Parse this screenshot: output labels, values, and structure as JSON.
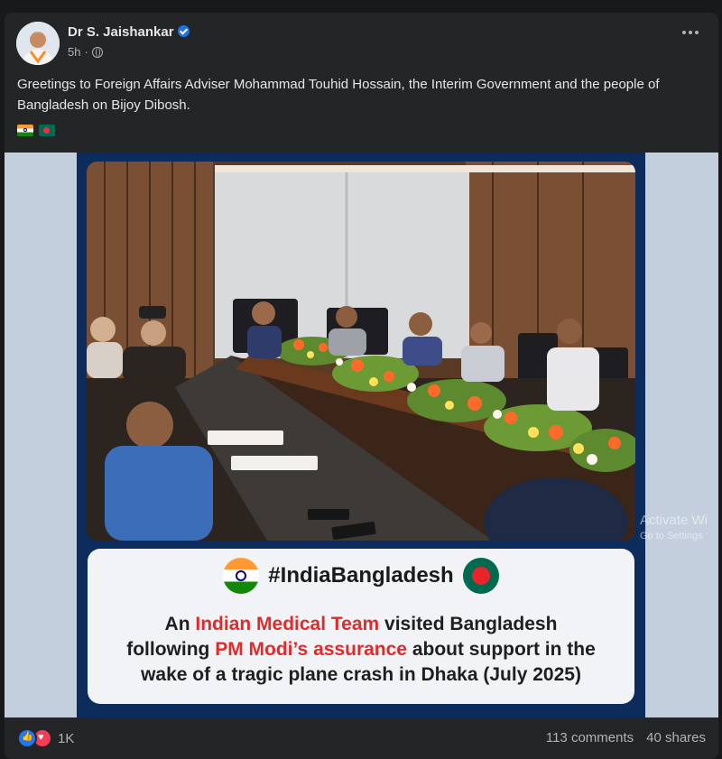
{
  "post": {
    "author": "Dr S. Jaishankar",
    "time": "5h",
    "text": "Greetings to Foreign Affairs Adviser Mohammad Touhid Hossain, the Interim Government and the people of Bangladesh on Bijoy Dibosh."
  },
  "poster": {
    "hashtag": "#IndiaBangladesh",
    "line1_a": "An ",
    "line1_highlight": "Indian Medical Team",
    "line1_b": " visited Bangladesh",
    "line2_a": "following ",
    "line2_highlight": "PM Modi’s assurance",
    "line2_b": " about support in the",
    "line3": "wake of a tragic plane crash in Dhaka (July 2025)"
  },
  "watermark": {
    "title": "Activate Wi",
    "subtitle": "Go to Settings"
  },
  "footer": {
    "reaction_count": "1K",
    "comments": "113 comments",
    "shares": "40 shares"
  },
  "icons": {
    "verified": "verified-badge-icon",
    "audience": "globe-icon",
    "more": "more-options-icon",
    "reactions": [
      "like-reaction-icon",
      "love-reaction-icon"
    ]
  },
  "colors": {
    "background": "#18191a",
    "card": "#242526",
    "poster_navy": "#0d2c5e",
    "highlight_red": "#e12a2a",
    "like_blue": "#2078f4",
    "love_red": "#f33e58"
  }
}
